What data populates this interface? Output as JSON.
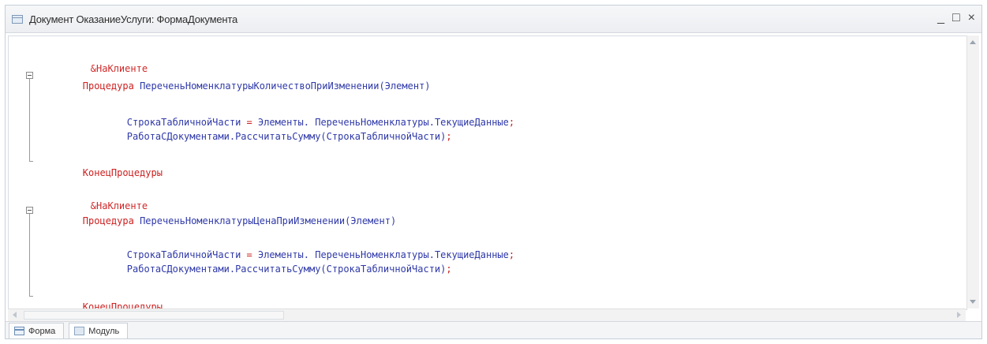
{
  "window": {
    "title": "Документ ОказаниеУслуги: ФормаДокумента",
    "minimize": "_",
    "maximize": "□",
    "close": "×"
  },
  "code": {
    "block1": {
      "annotation": "&НаКлиенте",
      "keyword": "Процедура",
      "name": "ПереченьНоменклатурыКоличествоПриИзменении",
      "params": "(Элемент)",
      "line1_var": "СтрокаТабличнойЧасти",
      "line1_op": " = ",
      "line1_expr": "Элементы. ПереченьНоменклатуры.ТекущиеДанные",
      "line1_end": ";",
      "line2_call": "РаботаСДокументами.РассчитатьСумму(СтрокаТабличнойЧасти)",
      "line2_end": ";",
      "end_keyword": "КонецПроцедуры"
    },
    "block2": {
      "annotation": "&НаКлиенте",
      "keyword": "Процедура",
      "name": "ПереченьНоменклатурыЦенаПриИзменении",
      "params": "(Элемент)",
      "line1_var": "СтрокаТабличнойЧасти",
      "line1_op": " = ",
      "line1_expr": "Элементы. ПереченьНоменклатуры.ТекущиеДанные",
      "line1_end": ";",
      "line2_call": "РаботаСДокументами.РассчитатьСумму(СтрокаТабличнойЧасти)",
      "line2_end": ";",
      "end_keyword": "КонецПроцедуры"
    }
  },
  "tabs": [
    {
      "label": "Форма"
    },
    {
      "label": "Модуль"
    }
  ],
  "colors": {
    "keyword": "#cc2020",
    "identifier": "#2f39a8"
  }
}
